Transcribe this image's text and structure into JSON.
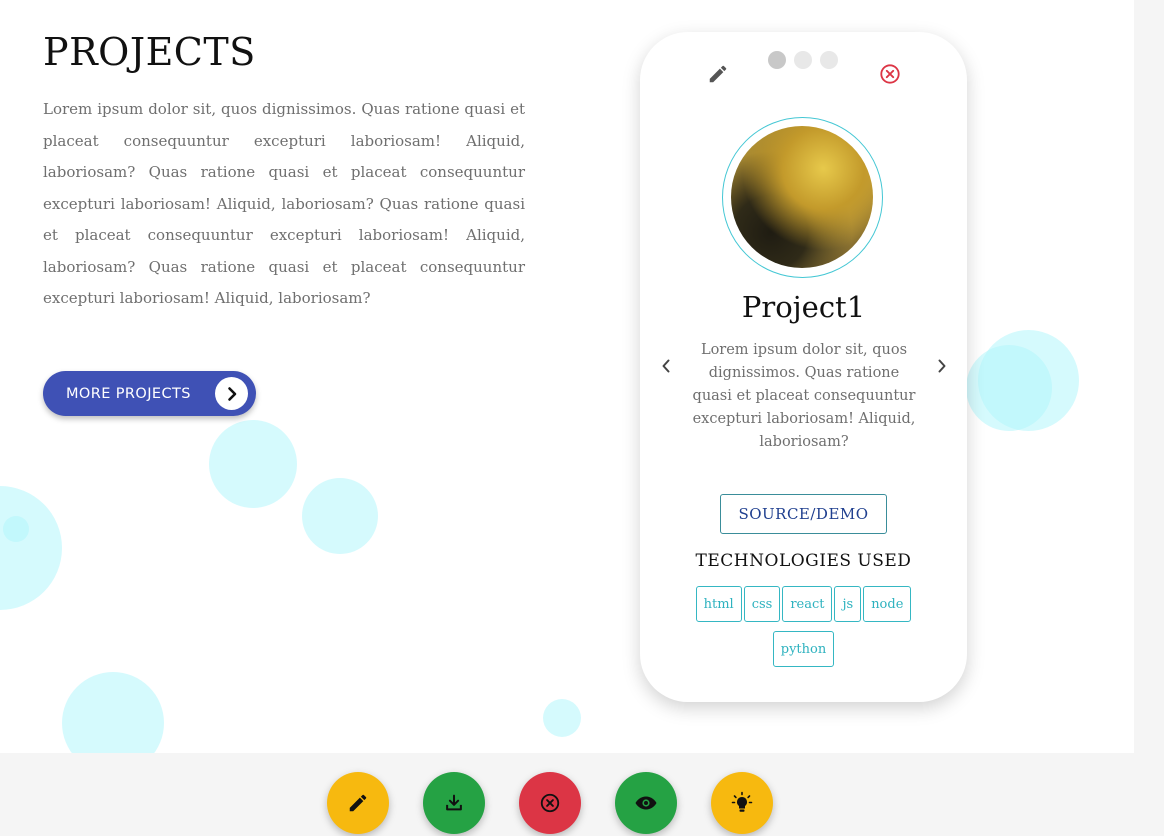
{
  "intro": {
    "title": "PROJECTS",
    "paragraph": "Lorem ipsum dolor sit, quos dignissimos. Quas ratione quasi et placeat consequuntur excepturi laboriosam! Aliquid, laboriosam? Quas ratione quasi et placeat consequuntur excepturi laboriosam! Aliquid, laboriosam? Quas ratione quasi et placeat consequuntur excepturi laboriosam! Aliquid, laboriosam? Quas ratione quasi et placeat consequuntur excepturi laboriosam! Aliquid, laboriosam?",
    "more_button_label": "MORE PROJECTS",
    "more_button_icon": "chevron-right-icon"
  },
  "card": {
    "project_title": "Project1",
    "description": "Lorem ipsum dolor sit, quos dignissimos. Quas ratione quasi et placeat consequuntur excepturi laboriosam! Aliquid, laboriosam?",
    "source_button_label": "SOURCE/DEMO",
    "tech_heading": "TECHNOLOGIES USED",
    "technologies": [
      "html",
      "css",
      "react",
      "js",
      "node",
      "python"
    ],
    "slide_count": 3,
    "active_slide": 1,
    "icons": {
      "edit": "pencil-icon",
      "close": "close-circle-icon",
      "prev": "chevron-left-icon",
      "next": "chevron-right-icon"
    }
  },
  "toolbar": {
    "buttons": [
      {
        "name": "edit-fab",
        "icon": "pencil-icon",
        "color": "#f7b90f"
      },
      {
        "name": "download-fab",
        "icon": "download-icon",
        "color": "#25a244"
      },
      {
        "name": "close-fab",
        "icon": "close-circle-icon",
        "color": "#dc3545"
      },
      {
        "name": "preview-fab",
        "icon": "eye-icon",
        "color": "#25a244"
      },
      {
        "name": "theme-fab",
        "icon": "lightbulb-icon",
        "color": "#f7b90f"
      }
    ]
  },
  "colors": {
    "accent_blue": "#3f51b5",
    "teal": "#35b7c3",
    "bubble": "#b2f5fc",
    "close_red": "#dc3545"
  }
}
